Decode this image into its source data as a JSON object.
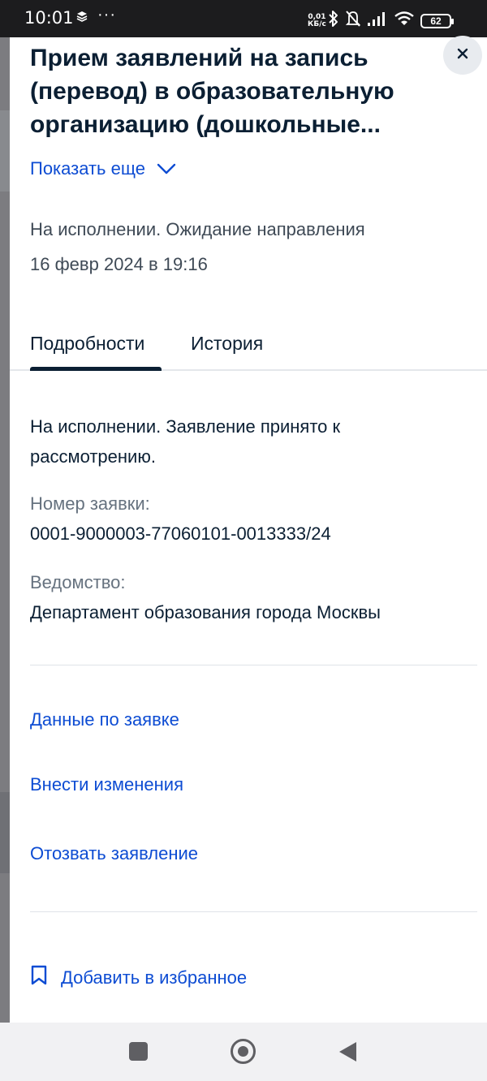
{
  "status_bar": {
    "time": "10:01",
    "dots": "···",
    "net_speed_value": "0,01",
    "net_speed_unit": "КБ/c",
    "battery": "62"
  },
  "sheet": {
    "title": "Прием заявлений на запись (перевод) в образовательную организацию (дошкольные...",
    "show_more": "Показать еще",
    "status": "На исполнении. Ожидание направления",
    "date": "16 февр 2024 в 19:16"
  },
  "tabs": [
    {
      "label": "Подробности",
      "active": true
    },
    {
      "label": "История",
      "active": false
    }
  ],
  "details": {
    "description": "На исполнении. Заявление принято к рассмотрению.",
    "request_number_label": "Номер заявки:",
    "request_number": "0001-9000003-77060101-0013333/24",
    "agency_label": "Ведомство:",
    "agency": "Департамент образования города Москвы"
  },
  "actions": {
    "request_data": "Данные по заявке",
    "edit": "Внести изменения",
    "withdraw": "Отозвать заявление",
    "add_favorite": "Добавить в избранное"
  },
  "colors": {
    "link": "#0d4cd3",
    "text": "#0b1f33",
    "muted": "#66727f",
    "status_bar": "#1c1c1e"
  },
  "icons": {
    "close": "close-icon",
    "show_more": "chevron-down-icon",
    "favorite": "bookmark-icon"
  }
}
